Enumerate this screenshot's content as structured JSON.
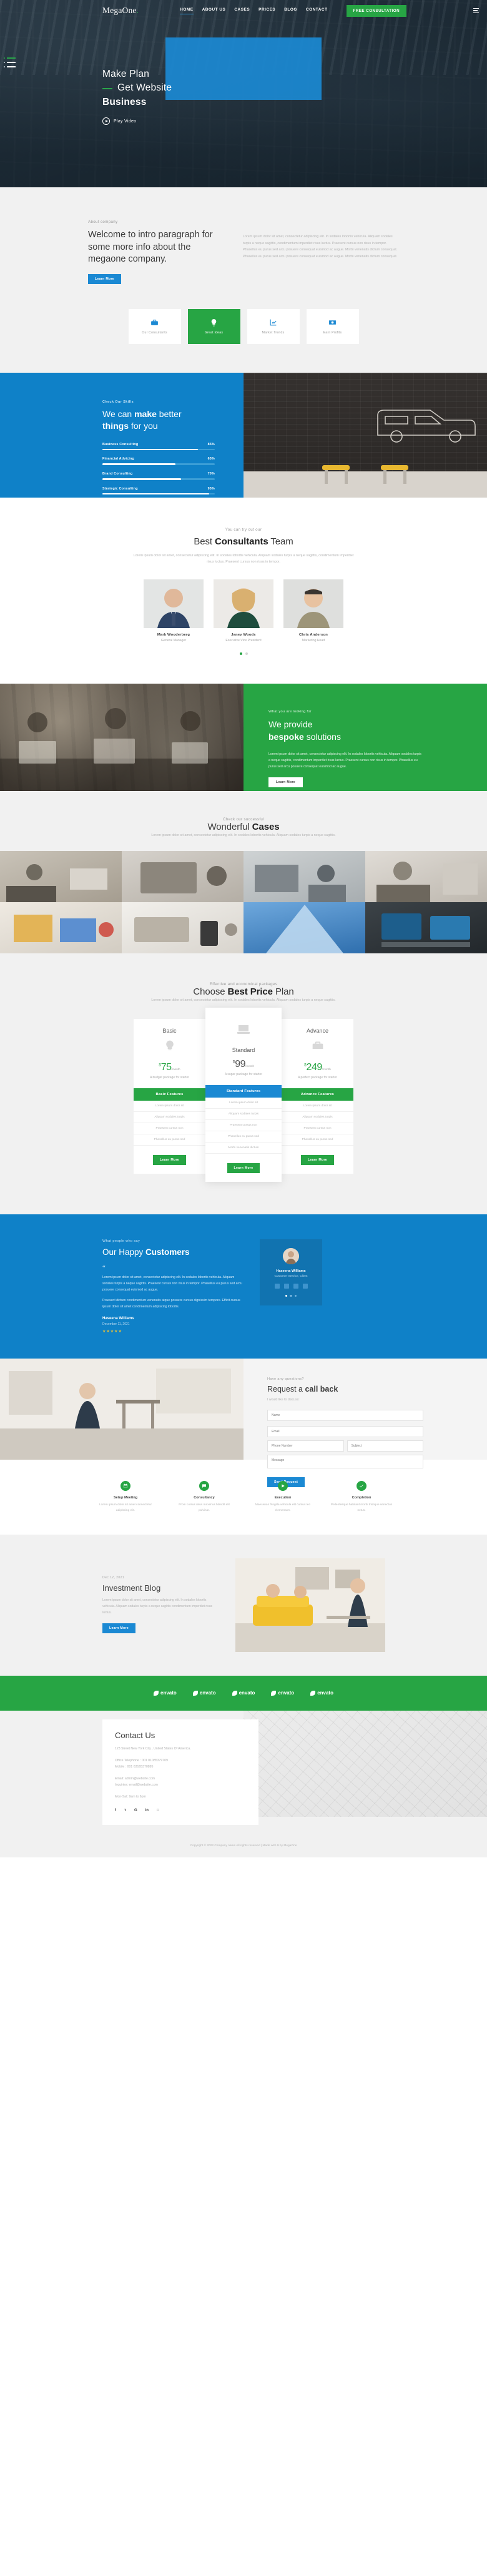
{
  "header": {
    "brand": "MegaOne",
    "nav": [
      {
        "label": "HOME",
        "active": true
      },
      {
        "label": "ABOUT US",
        "active": false
      },
      {
        "label": "CASES",
        "active": false
      },
      {
        "label": "PRICES",
        "active": false
      },
      {
        "label": "BLOG",
        "active": false
      },
      {
        "label": "CONTACT",
        "active": false
      }
    ],
    "cta": "FREE CONSULTATION"
  },
  "hero": {
    "line1": "Make Plan",
    "line2": "Get Website",
    "line3": "Business",
    "play": "Play Video"
  },
  "about": {
    "eyebrow": "About company",
    "title": "Welcome to intro paragraph for some more info about the megaone company.",
    "button": "Learn More",
    "paragraph": "Lorem ipsum dolor sit amet, consectetur adipiscing elit. In sodales lobortis vehicula. Aliquam sodales turpis a neque sagittis, condimentum imperdiet risus luctus. Praesent cursus non risus in tempor. Phasellus eu purus sed arcu posuere consequat euismod ac augue. Morbi venenatis dictum consequat. Phasellus eu purus sed arcu posuere consequat euismod ac augue. Morbi venenatis dictum consequat.",
    "services": [
      {
        "label": "Our Consultants",
        "icon": "briefcase-icon",
        "active": false
      },
      {
        "label": "Great Ideas",
        "icon": "lightbulb-icon",
        "active": true
      },
      {
        "label": "Market Trends",
        "icon": "chart-line-icon",
        "active": false
      },
      {
        "label": "Earn Profits",
        "icon": "money-icon",
        "active": false
      }
    ]
  },
  "skills": {
    "eyebrow": "Check Our Skills",
    "title_pre": "We can ",
    "title_bold": "make",
    "title_post": " better",
    "title_line2_bold": "things",
    "title_line2_post": " for you",
    "bars": [
      {
        "label": "Business Consulting",
        "value": "85%",
        "pct": 85
      },
      {
        "label": "Financial Advicing",
        "value": "65%",
        "pct": 65
      },
      {
        "label": "Brand Consulting",
        "value": "70%",
        "pct": 70
      },
      {
        "label": "Strategic Consulting",
        "value": "95%",
        "pct": 95
      }
    ]
  },
  "team": {
    "eyebrow": "You can try out our",
    "title_pre": "Best ",
    "title_bold": "Consultants",
    "title_post": " Team",
    "desc": "Lorem ipsum dolor sit amet, consectetur adipiscing elit. In sodales lobortis vehicula. Aliquam sodales turpis a neque sagittis, condimentum imperdiet risus luctus. Praesent cursus non risus in tempor.",
    "members": [
      {
        "name": "Mark Wooderberg",
        "role": "General Manager"
      },
      {
        "name": "Janey Woods",
        "role": "Executive Vice President"
      },
      {
        "name": "Chris Anderson",
        "role": "Marketing Head"
      }
    ]
  },
  "bespoke": {
    "eyebrow": "What you are looking for",
    "title_line1": "We provide",
    "title_bold": "bespoke",
    "title_post": " solutions",
    "paragraph": "Lorem ipsum dolor sit amet, consectetur adipiscing elit. In sodales lobortis vehicula. Aliquam sodales turpis a neque sagittis, condimentum imperdiet risus luctus. Praesent cursus non risus in tempor. Phasellus eu purus sed arcu posuere consequat euismod ac augue.",
    "button": "Learn More"
  },
  "cases": {
    "eyebrow": "Check our successful",
    "title_pre": "Wonderful ",
    "title_bold": "Cases",
    "desc": "Lorem ipsum dolor sit amet, consectetur adipiscing elit. In sodales lobortis vehicula. Aliquam sodales turpis a neque sagittis."
  },
  "pricing": {
    "eyebrow": "Effective and economical packages",
    "title_pre": "Choose ",
    "title_bold": "Best Price",
    "title_post": " Plan",
    "desc": "Lorem ipsum dolor sit amet, consectetur adipiscing elit. In sodales lobortis vehicula. Aliquam sodales turpis a neque sagittis.",
    "plans": [
      {
        "name": "Basic",
        "icon": "lightbulb-icon",
        "currency": "$",
        "amount": "75",
        "per": "/month",
        "sub": "A budget package for starter",
        "features_head": "Basic Features",
        "features": [
          "Lorem ipsum dolor sit",
          "Aliquam sodales turpis",
          "Praesent cursus non",
          "Phasellus eu purus sed"
        ],
        "button": "Learn More"
      },
      {
        "name": "Standard",
        "icon": "laptop-icon",
        "currency": "$",
        "amount": "99",
        "per": "/month",
        "sub": "A super package for starter",
        "features_head": "Standard Features",
        "features": [
          "Lorem ipsum dolor sit",
          "Aliquam sodales turpis",
          "Praesent cursus non",
          "Phasellus eu purus sed",
          "Morbi venenatis dictum"
        ],
        "button": "Learn More"
      },
      {
        "name": "Advance",
        "icon": "briefcase-icon",
        "currency": "$",
        "amount": "249",
        "per": "/month",
        "sub": "A perfect package for starter",
        "features_head": "Advance Features",
        "features": [
          "Lorem ipsum dolor sit",
          "Aliquam sodales turpis",
          "Praesent cursus non",
          "Phasellus eu purus sed"
        ],
        "button": "Learn More"
      }
    ]
  },
  "testimonial": {
    "eyebrow": "What people who say",
    "title_pre": "Our Happy ",
    "title_bold": "Customers",
    "quote_mark": "“",
    "text": "Lorem ipsum dolor sit amet, consectetur adipiscing elit. In sodales lobortis vehicula. Aliquam sodales turpis a neque sagittis. Praesent cursus non risus in tempor. Phasellus eu purus sed arcu posuere consequat euismod ac augue.",
    "text2": "Praesent dictum condimentum venenatis atque posuere cursus dignissim tempore. Efficit cursus ipsum dolor sit amet condimentum adipiscing lobortis.",
    "author": "Haseena Williams",
    "date": "December 11, 2021",
    "stars": "★★★★★",
    "card_name": "Haseena Williams",
    "card_role": "Customer Service, Client"
  },
  "callback": {
    "eyebrow": "Have any questions?",
    "title_pre": "Request a ",
    "title_bold": "call back",
    "lead": "I would like to discuss:",
    "fields": [
      {
        "name": "name",
        "placeholder": "Name"
      },
      {
        "name": "email",
        "placeholder": "Email"
      },
      {
        "name": "phone",
        "placeholder": "Phone Number"
      },
      {
        "name": "subject",
        "placeholder": "Subject"
      }
    ],
    "message_placeholder": "Message",
    "button": "Send Request"
  },
  "features": [
    {
      "title": "Setup Meeting",
      "desc": "Lorem ipsum dolor sit amet consectetur adipiscing elit.",
      "icon": "calendar-icon"
    },
    {
      "title": "Consultancy",
      "desc": "Proin cursus risus maximus blandit elit pulvinar.",
      "icon": "chat-icon"
    },
    {
      "title": "Execution",
      "desc": "Maecenas fringilla vehicula elit cursus leo elementum.",
      "icon": "play-icon"
    },
    {
      "title": "Completion",
      "desc": "Pellentesque habitant morbi tristique senectus netus.",
      "icon": "check-icon"
    }
  ],
  "blog": {
    "eyebrow": "Dec 12, 2021",
    "title": "Investment Blog",
    "paragraph": "Lorem ipsum dolor sit amet, consectetur adipiscing elit. In sodales lobortis vehicula. Aliquam sodales turpis a neque sagittis condimentum imperdiet risus luctus.",
    "button": "Learn More"
  },
  "envato": {
    "items": [
      "envato",
      "envato",
      "envato",
      "envato",
      "envato"
    ]
  },
  "contact": {
    "title": "Contact Us",
    "address": "123 Street New York City , United States Of America.",
    "phone_office": "Office Telephone : 001 01085379709",
    "phone_mobile": "Mobile : 001 63165370895",
    "email": "Email: admin@website.com",
    "inquiries": "Inquiries: email@website.com",
    "hours": "Mon-Sat: 9am to 6pm",
    "socials": [
      "f",
      "ᴛ",
      "G",
      "in",
      "□"
    ]
  },
  "copyright": "Copyright © 2022 Company name All rights reserved | Made with ♥ by MegaOne",
  "colors": {
    "blue": "#0f81c8",
    "green": "#27a544",
    "dark": "#22303c",
    "light": "#f1f1f1"
  }
}
